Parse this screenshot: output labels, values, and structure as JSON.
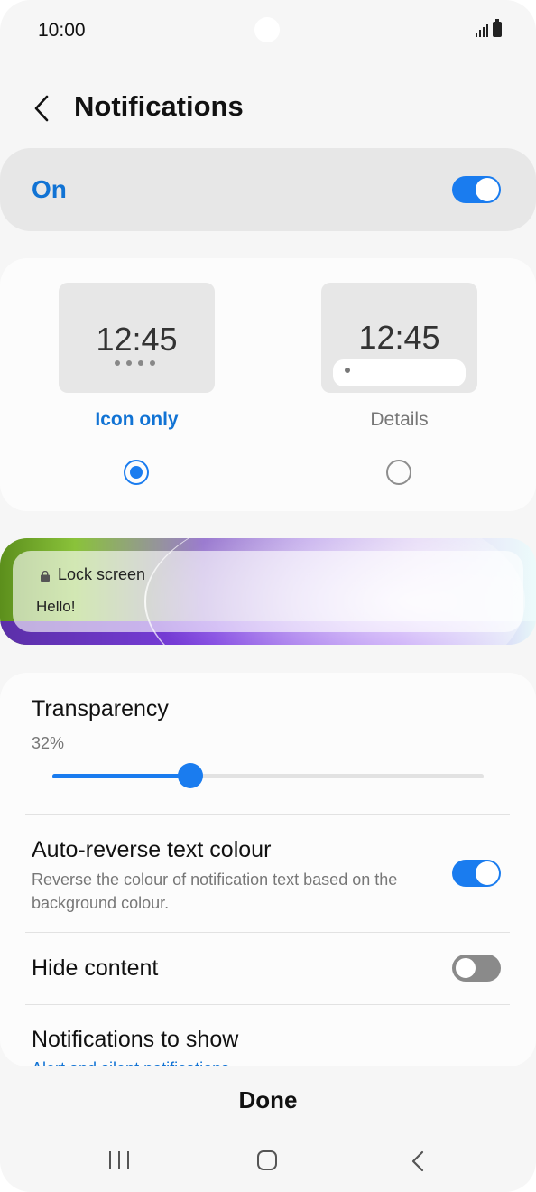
{
  "status_bar": {
    "time": "10:00"
  },
  "header": {
    "title": "Notifications"
  },
  "master_toggle": {
    "label": "On",
    "state": "on"
  },
  "notification_style": {
    "options": [
      {
        "preview_time": "12:45",
        "label": "Icon only",
        "selected": true
      },
      {
        "preview_time": "12:45",
        "label": "Details",
        "selected": false
      }
    ]
  },
  "lock_preview": {
    "title": "Lock screen",
    "message": "Hello!"
  },
  "settings": {
    "transparency": {
      "title": "Transparency",
      "value_text": "32%",
      "value": 0.32
    },
    "auto_reverse": {
      "title": "Auto-reverse text colour",
      "subtitle": "Reverse the colour of notification text based on the background colour.",
      "state": "on"
    },
    "hide_content": {
      "title": "Hide content",
      "state": "off"
    },
    "notifications_to_show": {
      "title": "Notifications to show",
      "value": "Alert and silent notifications"
    }
  },
  "footer": {
    "done_label": "Done"
  },
  "colors": {
    "accent": "#1a7cef",
    "accent_text": "#1173d4",
    "background": "#f6f6f6"
  }
}
